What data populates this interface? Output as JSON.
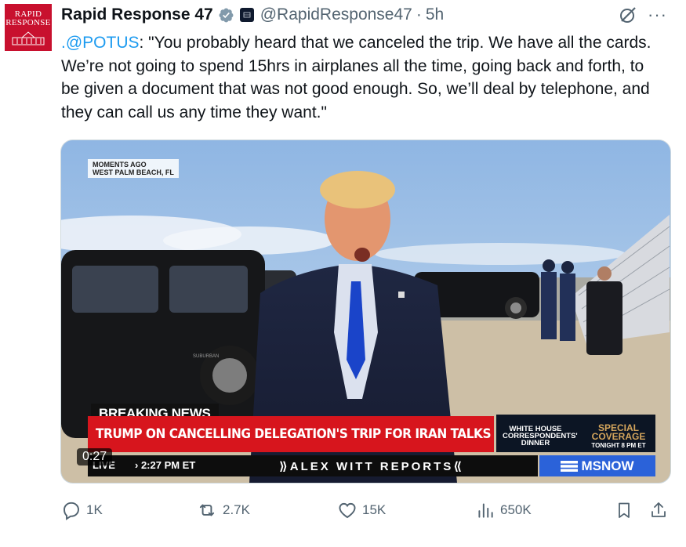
{
  "avatar": {
    "line1": "RAPID",
    "line2": "RESPONSE"
  },
  "header": {
    "name": "Rapid Response 47",
    "handle": "@RapidResponse47",
    "separator": "·",
    "time": "5h",
    "more": "···"
  },
  "tweet": {
    "mention": ".@POTUS",
    "text": ": \"You probably heard that we canceled the trip. We have all the cards. We’re not going to spend 15hrs in airplanes all the time, going back and forth, to be given a document that was not good enough. So, we’ll deal by telephone, and they can call us any time they want.\""
  },
  "media": {
    "moments_ago": "MOMENTS AGO",
    "location": "WEST PALM BEACH, FL",
    "breaking": "BREAKING NEWS",
    "headline": "TRUMP ON CANCELLING DELEGATION'S TRIP FOR IRAN TALKS",
    "wh_title": "WHITE HOUSE CORRESPONDENTS' DINNER",
    "special": "SPECIAL COVERAGE",
    "tonight": "TONIGHT 8 PM ET",
    "live": "LIVE",
    "live_time": "› 2:27 PM ET",
    "anchor": "⟫ALEX WITT REPORTS⟪",
    "network": "MSNOW",
    "video_time": "0:27",
    "suv_badge": "SUBURBAN"
  },
  "actions": {
    "replies": "1K",
    "reposts": "2.7K",
    "likes": "15K",
    "views": "650K"
  },
  "colors": {
    "link": "#1d9bf0",
    "muted": "#536471",
    "banner_red": "#d7151d",
    "msnow_blue": "#2b62d9"
  }
}
